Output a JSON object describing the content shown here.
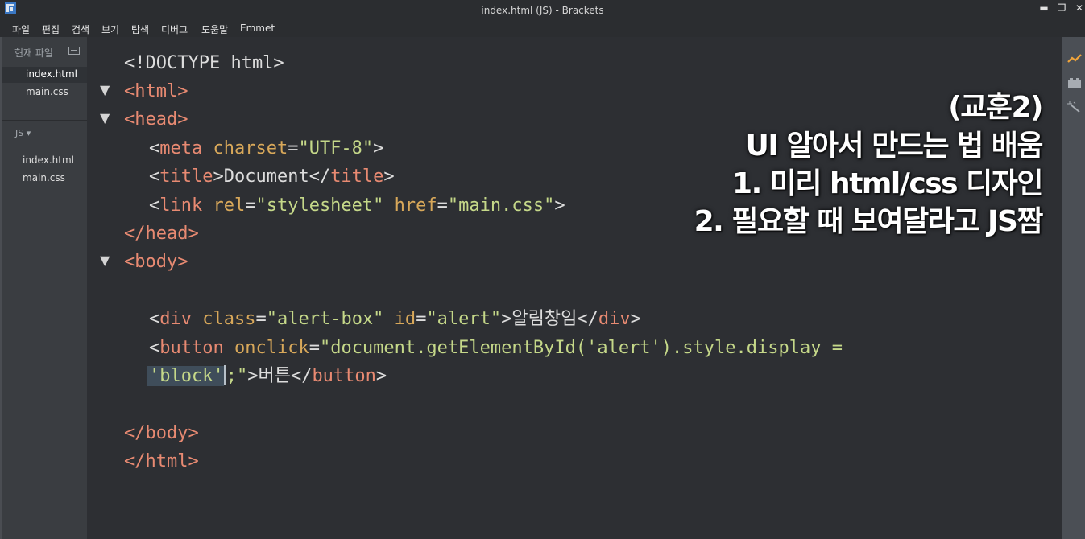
{
  "window": {
    "title": "index.html (JS) - Brackets",
    "minimize": "▬",
    "maximize": "❐",
    "close": "✕"
  },
  "menu": [
    "파일",
    "편집",
    "검색",
    "보기",
    "탐색",
    "디버그",
    "도움말",
    "Emmet"
  ],
  "sidebar": {
    "working_files_header": "현재 파일",
    "working_files": [
      "index.html",
      "main.css"
    ],
    "active_file": "index.html",
    "project_header": "JS ▾",
    "project_files": [
      "index.html",
      "main.css"
    ]
  },
  "editor": {
    "lines": {
      "l1": "<!DOCTYPE html>",
      "l2_fold": "▼",
      "l2": "<html>",
      "l3_fold": "▼",
      "l3": "<head>",
      "l4a": "<",
      "l4b": "meta",
      "l4c": " charset",
      "l4d": "=",
      "l4e": "\"UTF-8\"",
      "l4f": ">",
      "l5a": "<",
      "l5b": "title",
      "l5c": ">Document</",
      "l5d": "title",
      "l5e": ">",
      "l6a": "<",
      "l6b": "link",
      "l6c": " rel",
      "l6d": "=",
      "l6e": "\"stylesheet\"",
      "l6f": " href",
      "l6g": "=",
      "l6h": "\"main.css\"",
      "l6i": ">",
      "l7": "</head>",
      "l8_fold": "▼",
      "l8": "<body>",
      "l10a": "<",
      "l10b": "div",
      "l10c": " class",
      "l10d": "=",
      "l10e": "\"alert-box\"",
      "l10f": " id",
      "l10g": "=",
      "l10h": "\"alert\"",
      "l10i": ">알림창임</",
      "l10j": "div",
      "l10k": ">",
      "l11a": "<",
      "l11b": "button",
      "l11c": " onclick",
      "l11d": "=",
      "l11e": "\"document.getElementById('alert').style.display =",
      "l12a": "'block'",
      "l12b": ";\"",
      "l12c": ">버튼</",
      "l12d": "button",
      "l12e": ">",
      "l14": "</body>",
      "l15": "</html>"
    }
  },
  "overlay": {
    "line1": "(교훈2)",
    "line2": "UI 알아서 만드는 법 배움",
    "line3": "1. 미리 html/css 디자인",
    "line4": "2. 필요할 때 보여달라고 JS짬"
  },
  "right_toolbar": [
    "live-preview-icon",
    "extension-manager-icon",
    "magic-wand-icon"
  ],
  "colors": {
    "tag": "#e88a72",
    "attribute": "#d8a85a",
    "string": "#c5d889",
    "editor_bg": "#2d2f33",
    "sidebar_bg": "#3a3d41",
    "live_preview_icon": "#f0a43a"
  }
}
